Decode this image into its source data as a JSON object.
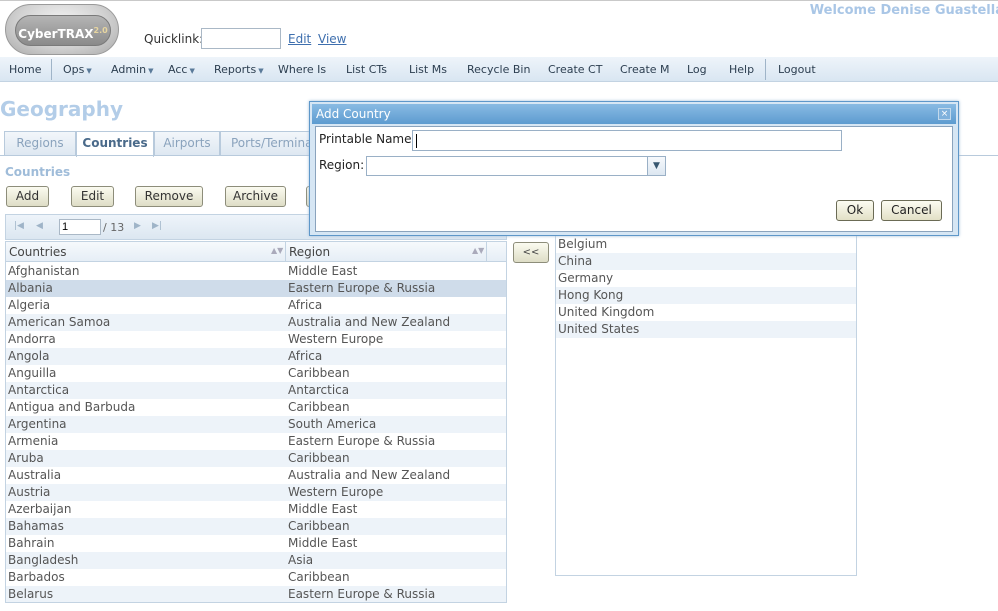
{
  "header": {
    "logo_text": "CyberTRAX",
    "logo_version": "2.0",
    "quicklink_label": "Quicklink:",
    "quicklink_value": "",
    "edit_link": "Edit",
    "view_link": "View",
    "welcome": "Welcome Denise Guastella"
  },
  "nav": {
    "home": "Home",
    "ops": "Ops",
    "admin": "Admin",
    "acc": "Acc",
    "reports": "Reports",
    "whereis": "Where Is",
    "listcts": "List CTs",
    "listms": "List Ms",
    "recyclebin": "Recycle Bin",
    "createct": "Create CT",
    "createm": "Create M",
    "log": "Log",
    "help": "Help",
    "logout": "Logout"
  },
  "page": {
    "title": "Geography",
    "tabs": [
      "Regions",
      "Countries",
      "Airports",
      "Ports/Terminals"
    ],
    "active_tab": "Countries",
    "section_title": "Countries"
  },
  "toolbar": {
    "add": "Add",
    "edit": "Edit",
    "remove": "Remove",
    "archive": "Archive"
  },
  "pager": {
    "current_page": "1",
    "total": "/ 13"
  },
  "grid": {
    "headers": [
      "Countries",
      "Region"
    ],
    "rows": [
      [
        "Afghanistan",
        "Middle East"
      ],
      [
        "Albania",
        "Eastern Europe & Russia"
      ],
      [
        "Algeria",
        "Africa"
      ],
      [
        "American Samoa",
        "Australia and New Zealand"
      ],
      [
        "Andorra",
        "Western Europe"
      ],
      [
        "Angola",
        "Africa"
      ],
      [
        "Anguilla",
        "Caribbean"
      ],
      [
        "Antarctica",
        "Antarctica"
      ],
      [
        "Antigua and Barbuda",
        "Caribbean"
      ],
      [
        "Argentina",
        "South America"
      ],
      [
        "Armenia",
        "Eastern Europe & Russia"
      ],
      [
        "Aruba",
        "Caribbean"
      ],
      [
        "Australia",
        "Australia and New Zealand"
      ],
      [
        "Austria",
        "Western Europe"
      ],
      [
        "Azerbaijan",
        "Middle East"
      ],
      [
        "Bahamas",
        "Caribbean"
      ],
      [
        "Bahrain",
        "Middle East"
      ],
      [
        "Bangladesh",
        "Asia"
      ],
      [
        "Barbados",
        "Caribbean"
      ],
      [
        "Belarus",
        "Eastern Europe & Russia"
      ]
    ],
    "selected_row": 1
  },
  "move_button": "<<",
  "selected_countries": [
    "Belgium",
    "China",
    "Germany",
    "Hong Kong",
    "United Kingdom",
    "United States"
  ],
  "dialog": {
    "title": "Add Country",
    "printable_name_label": "Printable Name:",
    "printable_name_value": "",
    "region_label": "Region:",
    "region_value": "",
    "ok": "Ok",
    "cancel": "Cancel"
  }
}
